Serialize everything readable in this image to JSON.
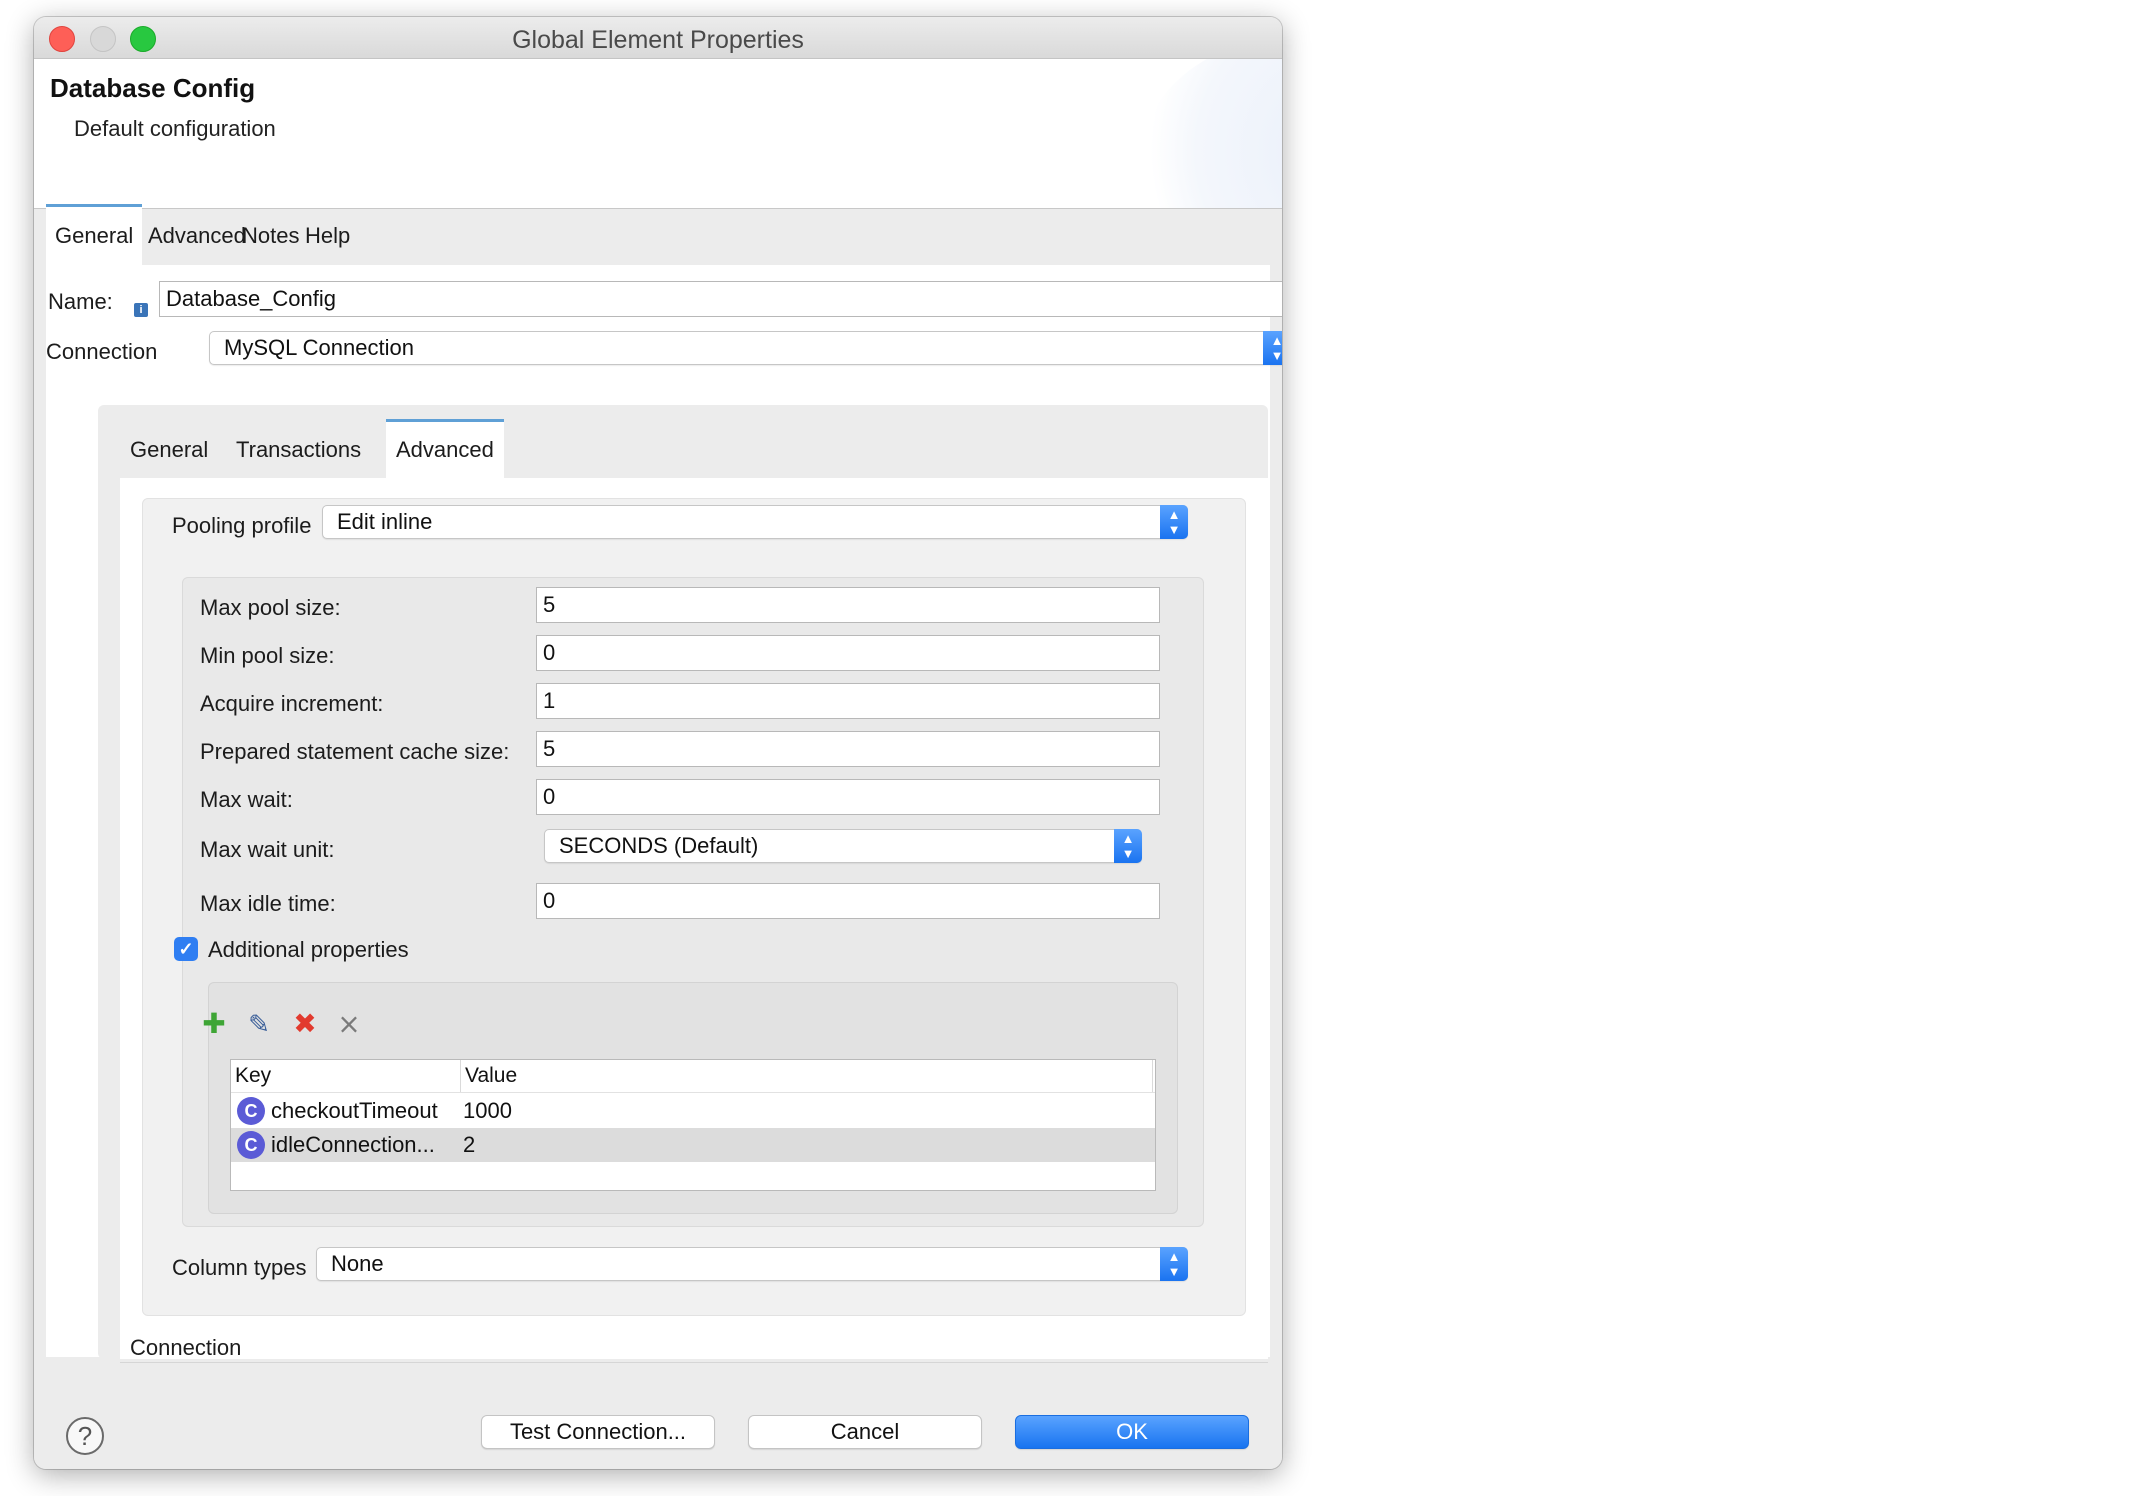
{
  "window": {
    "title": "Global Element Properties"
  },
  "header": {
    "title": "Database Config",
    "subtitle": "Default configuration"
  },
  "tabs": [
    {
      "label": "General",
      "active": true
    },
    {
      "label": "Advanced",
      "active": false
    },
    {
      "label": "Notes",
      "active": false
    },
    {
      "label": "Help",
      "active": false
    }
  ],
  "form": {
    "name_label": "Name:",
    "name_value": "Database_Config",
    "connection_label": "Connection",
    "connection_value": "MySQL Connection"
  },
  "inner_tabs": [
    {
      "label": "General",
      "active": false
    },
    {
      "label": "Transactions",
      "active": false
    },
    {
      "label": "Advanced",
      "active": true
    }
  ],
  "advanced": {
    "pooling_profile_label": "Pooling profile",
    "pooling_profile_value": "Edit inline",
    "fields": [
      {
        "label": "Max pool size:",
        "value": "5"
      },
      {
        "label": "Min pool size:",
        "value": "0"
      },
      {
        "label": "Acquire increment:",
        "value": "1"
      },
      {
        "label": "Prepared statement cache size:",
        "value": "5"
      },
      {
        "label": "Max wait:",
        "value": "0"
      }
    ],
    "max_wait_unit_label": "Max wait unit:",
    "max_wait_unit_value": "SECONDS (Default)",
    "max_idle_time_label": "Max idle time:",
    "max_idle_time_value": "0",
    "additional_properties_label": "Additional properties",
    "additional_properties_checked": true,
    "properties_table": {
      "columns": [
        "Key",
        "Value"
      ],
      "rows": [
        {
          "key": "checkoutTimeout",
          "value": "1000",
          "selected": false
        },
        {
          "key": "idleConnection...",
          "value": "2",
          "selected": true
        }
      ]
    },
    "column_types_label": "Column types",
    "column_types_value": "None",
    "connection_section_label": "Connection"
  },
  "toolbar_icons": [
    "add-icon",
    "edit-icon",
    "delete-icon",
    "clear-all-icon"
  ],
  "footer": {
    "help_symbol": "?",
    "test_connection_label": "Test Connection...",
    "cancel_label": "Cancel",
    "ok_label": "OK"
  },
  "colors": {
    "accent": "#1a73f0",
    "tab_indicator": "#5fa0d6",
    "close": "#fe5f57",
    "zoom": "#28c840"
  }
}
